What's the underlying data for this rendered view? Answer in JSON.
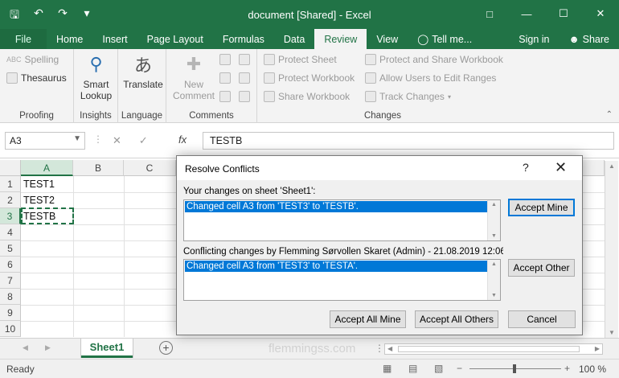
{
  "title": "document  [Shared] - Excel",
  "tabs": [
    "File",
    "Home",
    "Insert",
    "Page Layout",
    "Formulas",
    "Data",
    "Review",
    "View"
  ],
  "tell_me": "Tell me...",
  "sign_in": "Sign in",
  "share": "Share",
  "ribbon": {
    "proofing": {
      "spelling": "Spelling",
      "thesaurus": "Thesaurus",
      "label": "Proofing"
    },
    "insights": {
      "btn1": "Smart",
      "btn2": "Lookup",
      "label": "Insights"
    },
    "language": {
      "btn": "Translate",
      "label": "Language"
    },
    "comments": {
      "btn1": "New",
      "btn2": "Comment",
      "label": "Comments"
    },
    "changes": {
      "protect_sheet": "Protect Sheet",
      "protect_workbook": "Protect Workbook",
      "share_workbook": "Share Workbook",
      "protect_share": "Protect and Share Workbook",
      "allow_users": "Allow Users to Edit Ranges",
      "track_changes": "Track Changes",
      "label": "Changes"
    }
  },
  "namebox": "A3",
  "fx": "fx",
  "formula": "TESTB",
  "columns": [
    "A",
    "B",
    "C"
  ],
  "rows": [
    "1",
    "2",
    "3",
    "4",
    "5",
    "6",
    "7",
    "8",
    "9",
    "10"
  ],
  "cells": [
    "TEST1",
    "TEST2",
    "TESTB"
  ],
  "sheet_tab": "Sheet1",
  "watermark": "flemmingss.com",
  "status": {
    "ready": "Ready",
    "zoom": "100 %"
  },
  "dialog": {
    "title": "Resolve Conflicts",
    "help": "?",
    "your_changes_label": "Your changes on sheet 'Sheet1':",
    "your_change_item": "Changed cell A3 from 'TEST3' to 'TESTB'.",
    "conflict_label": "Conflicting changes by Flemming Sørvollen Skaret (Admin) - 21.08.2019 12:06:",
    "conflict_item": "Changed cell A3 from 'TEST3' to 'TESTA'.",
    "accept_mine": "Accept Mine",
    "accept_other": "Accept Other",
    "accept_all_mine": "Accept All Mine",
    "accept_all_others": "Accept All Others",
    "cancel": "Cancel"
  }
}
